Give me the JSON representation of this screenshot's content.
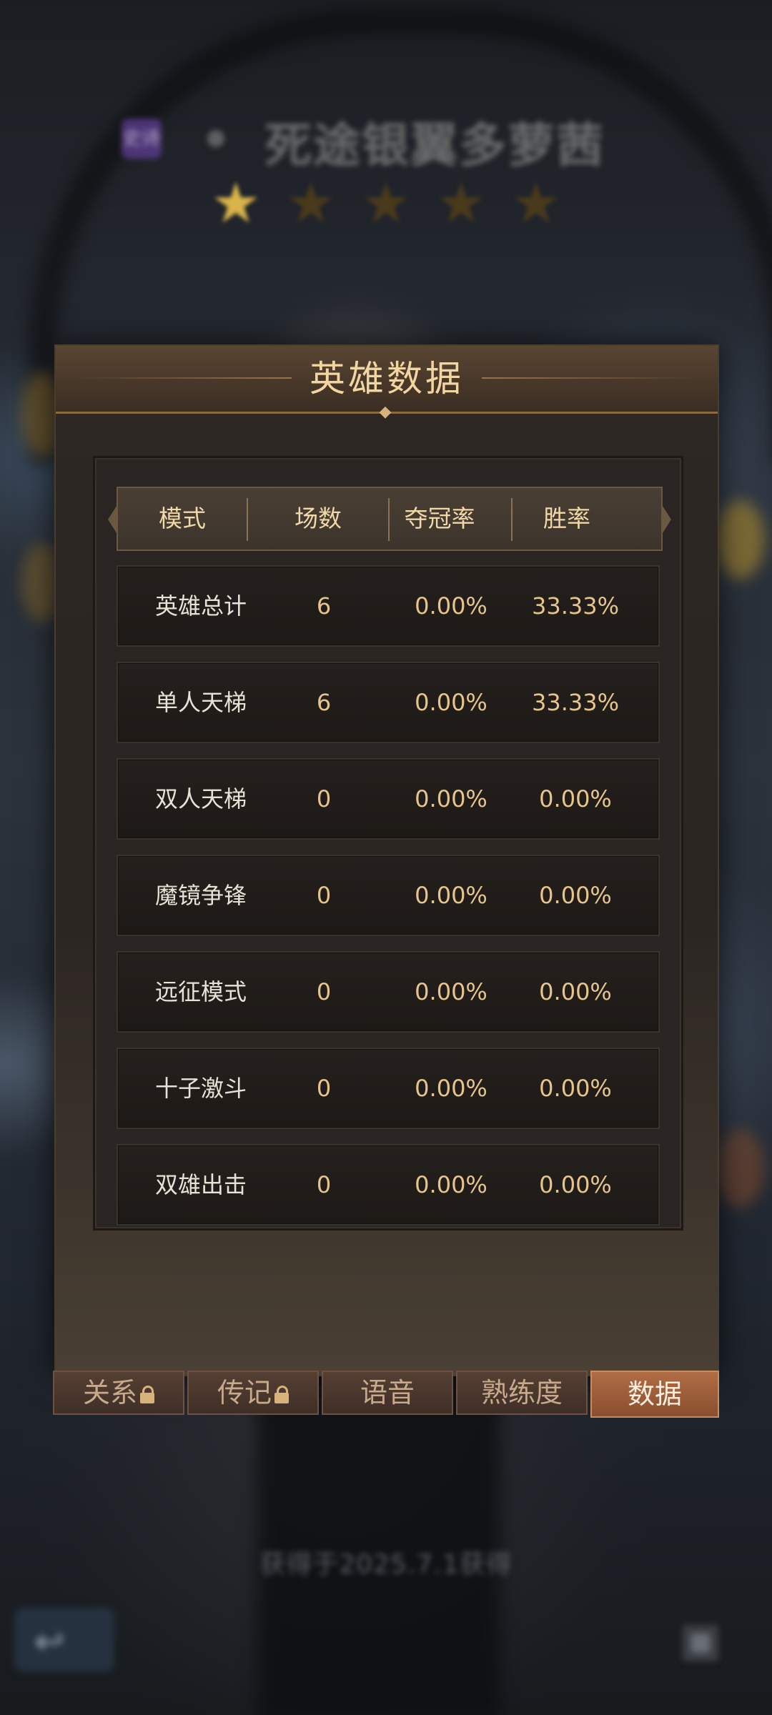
{
  "hero": {
    "badge": "史诗",
    "name": "死途银翼多萝茜",
    "stars_lit": 1,
    "stars_total": 5
  },
  "panel": {
    "title": "英雄数据",
    "columns": {
      "mode": "模式",
      "games": "场数",
      "champion_rate": "夺冠率",
      "win_rate": "胜率"
    },
    "rows": [
      {
        "mode": "英雄总计",
        "games": "6",
        "champion_rate": "0.00%",
        "win_rate": "33.33%"
      },
      {
        "mode": "单人天梯",
        "games": "6",
        "champion_rate": "0.00%",
        "win_rate": "33.33%"
      },
      {
        "mode": "双人天梯",
        "games": "0",
        "champion_rate": "0.00%",
        "win_rate": "0.00%"
      },
      {
        "mode": "魔镜争锋",
        "games": "0",
        "champion_rate": "0.00%",
        "win_rate": "0.00%"
      },
      {
        "mode": "远征模式",
        "games": "0",
        "champion_rate": "0.00%",
        "win_rate": "0.00%"
      },
      {
        "mode": "十子激斗",
        "games": "0",
        "champion_rate": "0.00%",
        "win_rate": "0.00%"
      },
      {
        "mode": "双雄出击",
        "games": "0",
        "champion_rate": "0.00%",
        "win_rate": "0.00%"
      }
    ]
  },
  "tabs": [
    {
      "label": "关系",
      "locked": true,
      "active": false
    },
    {
      "label": "传记",
      "locked": true,
      "active": false
    },
    {
      "label": "语音",
      "locked": false,
      "active": false
    },
    {
      "label": "熟练度",
      "locked": false,
      "active": false
    },
    {
      "label": "数据",
      "locked": false,
      "active": true
    }
  ],
  "footer_note": "获得于2025.7.1获得",
  "colors": {
    "accent_gold": "#f1d6a0",
    "value_gold": "#e6c48a",
    "active_tab": "#b06c45"
  },
  "icons": {
    "back": "back-arrow-icon",
    "lock": "lock-icon",
    "star": "star-icon"
  }
}
